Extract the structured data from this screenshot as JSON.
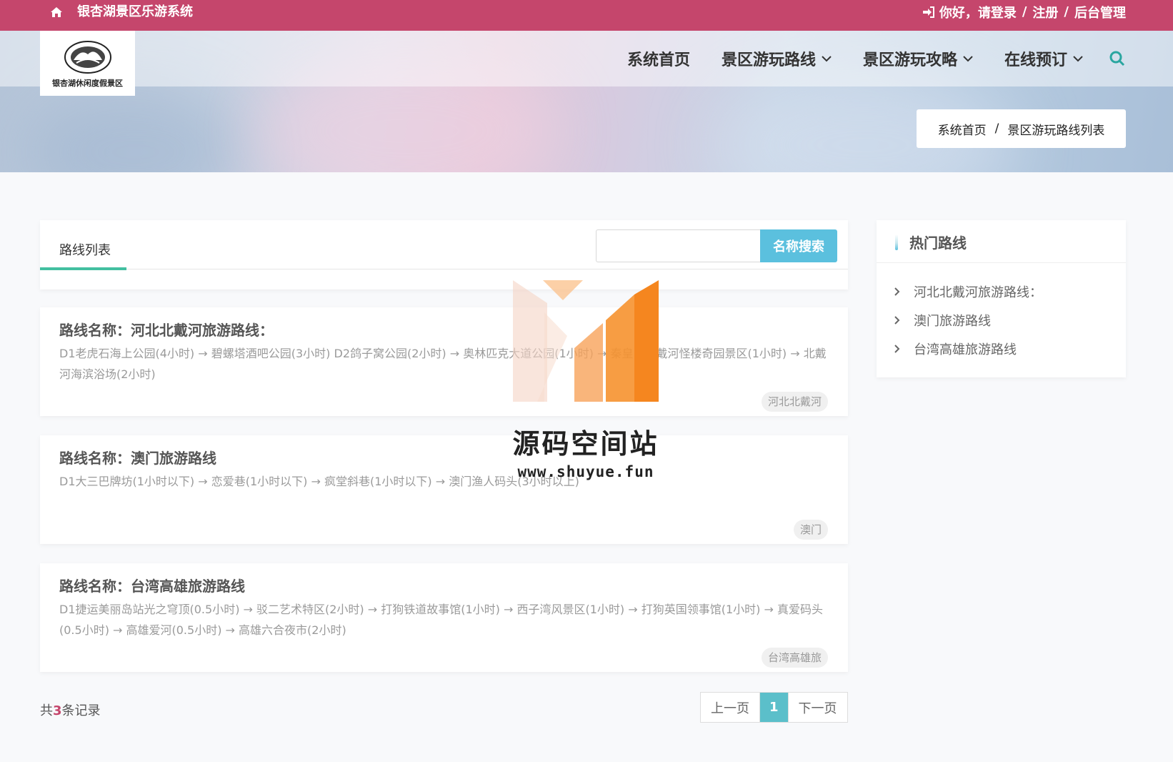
{
  "topbar": {
    "site_title": "银杏湖景区乐游系统",
    "greeting": "你好，请登录",
    "register": "注册",
    "admin": "后台管理"
  },
  "logo": {
    "text": "银杏湖休闲度假景区"
  },
  "nav": {
    "home": "系统首页",
    "routes": "景区游玩路线",
    "guides": "景区游玩攻略",
    "booking": "在线预订"
  },
  "breadcrumb": {
    "home": "系统首页",
    "current": "景区游玩路线列表"
  },
  "list": {
    "tab_label": "路线列表",
    "search_value": "",
    "search_placeholder": "",
    "search_button": "名称搜索"
  },
  "routes": [
    {
      "name": "路线名称：河北北戴河旅游路线：",
      "desc": "D1老虎石海上公园(4小时) → 碧螺塔酒吧公园(3小时) D2鸽子窝公园(2小时) → 奥林匹克大道公园(1小时) → 秦皇岛北戴河怪楼奇园景区(1小时) → 北戴河海滨浴场(2小时)",
      "tag": "河北北戴河"
    },
    {
      "name": "路线名称：澳门旅游路线",
      "desc": "D1大三巴牌坊(1小时以下) → 恋爱巷(1小时以下) → 疯堂斜巷(1小时以下) → 澳门渔人码头(3小时以上)",
      "tag": "澳门"
    },
    {
      "name": "路线名称：台湾高雄旅游路线",
      "desc": "D1捷运美丽岛站光之穹顶(0.5小时) → 驳二艺术特区(2小时) → 打狗铁道故事馆(1小时) → 西子湾风景区(1小时) → 打狗英国领事馆(1小时) → 真爱码头(0.5小时) → 高雄爱河(0.5小时) → 高雄六合夜市(2小时)",
      "tag": "台湾高雄旅"
    }
  ],
  "footer": {
    "total_prefix": "共",
    "total_count": "3",
    "total_suffix": "条记录"
  },
  "pager": {
    "prev": "上一页",
    "current": "1",
    "next": "下一页"
  },
  "sidebar": {
    "title": "热门路线",
    "items": [
      "河北北戴河旅游路线：",
      "澳门旅游路线",
      "台湾高雄旅游路线"
    ]
  },
  "watermark": {
    "name": "源码空间站",
    "url": "www.shuyue.fun"
  },
  "colors": {
    "topbar": "#c5466c",
    "accent_teal": "#42bfa0",
    "button_blue": "#5bc0de",
    "page_active": "#5bbfca",
    "watermark_orange": "#f5861f"
  }
}
